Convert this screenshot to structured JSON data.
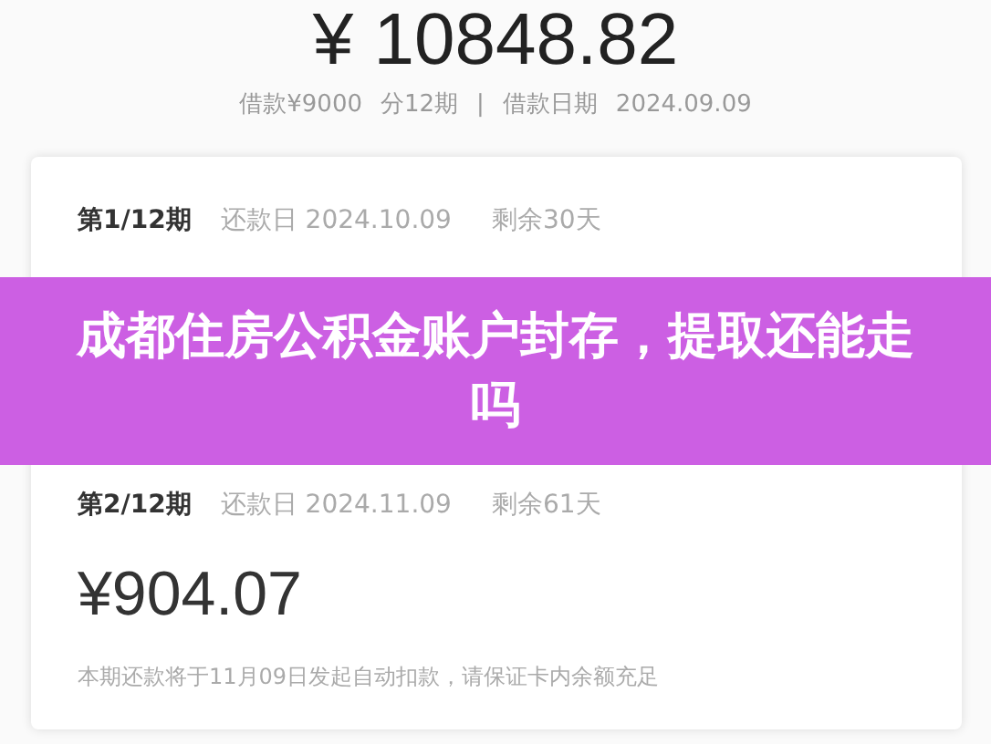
{
  "total": "¥ 10848.82",
  "summary": [
    "借款¥9000",
    "分12期",
    "|",
    "借款日期",
    "2024.09.09"
  ],
  "installments": [
    {
      "period": "第1/12期",
      "due": "还款日 2024.10.09",
      "remaining": "剩余30天"
    },
    {
      "period": "第2/12期",
      "due": "还款日 2024.11.09",
      "remaining": "剩余61天",
      "amount": "¥904.07",
      "note": "本期还款将于11月09日发起自动扣款，请保证卡内余额充足"
    }
  ],
  "banner": {
    "title": "成都住房公积金账户封存，提取还能走吗"
  }
}
